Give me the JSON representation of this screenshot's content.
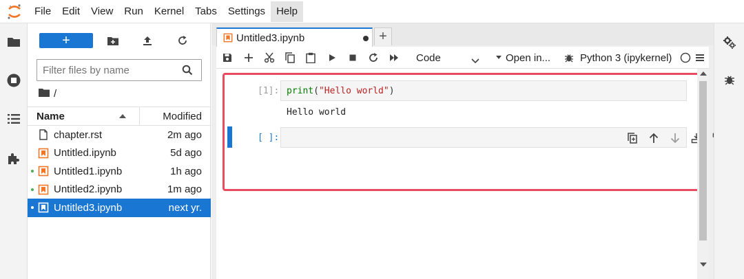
{
  "menu": [
    "File",
    "Edit",
    "View",
    "Run",
    "Kernel",
    "Tabs",
    "Settings",
    "Help"
  ],
  "menu_active": "Help",
  "filebrowser": {
    "new_button_label": "+",
    "filter_placeholder": "Filter files by name",
    "breadcrumb": "/",
    "column_name": "Name",
    "column_modified": "Modified",
    "files": [
      {
        "name": "chapter.rst",
        "modified": "2m ago",
        "type": "text",
        "running": false,
        "selected": false
      },
      {
        "name": "Untitled.ipynb",
        "modified": "5d ago",
        "type": "notebook",
        "running": false,
        "selected": false
      },
      {
        "name": "Untitled1.ipynb",
        "modified": "1h ago",
        "type": "notebook",
        "running": true,
        "selected": false
      },
      {
        "name": "Untitled2.ipynb",
        "modified": "1m ago",
        "type": "notebook",
        "running": true,
        "selected": false
      },
      {
        "name": "Untitled3.ipynb",
        "modified": "next yr.",
        "type": "notebook",
        "running": true,
        "selected": true
      }
    ]
  },
  "tab": {
    "title": "Untitled3.ipynb",
    "add_label": "+"
  },
  "toolbar": {
    "cell_type": "Code",
    "open_in": "Open in...",
    "kernel": "Python 3 (ipykernel)"
  },
  "cells": [
    {
      "prompt": "[1]:",
      "code_keyword": "print",
      "code_open": "(",
      "code_string": "\"Hello world\"",
      "code_close": ")",
      "output": "Hello world"
    },
    {
      "prompt": "[ ]:",
      "code": ""
    }
  ],
  "colors": {
    "accent": "#1976d2",
    "highlight": "#e94a5f",
    "notebook_icon": "#f37626",
    "running_dot": "#4caf50"
  }
}
